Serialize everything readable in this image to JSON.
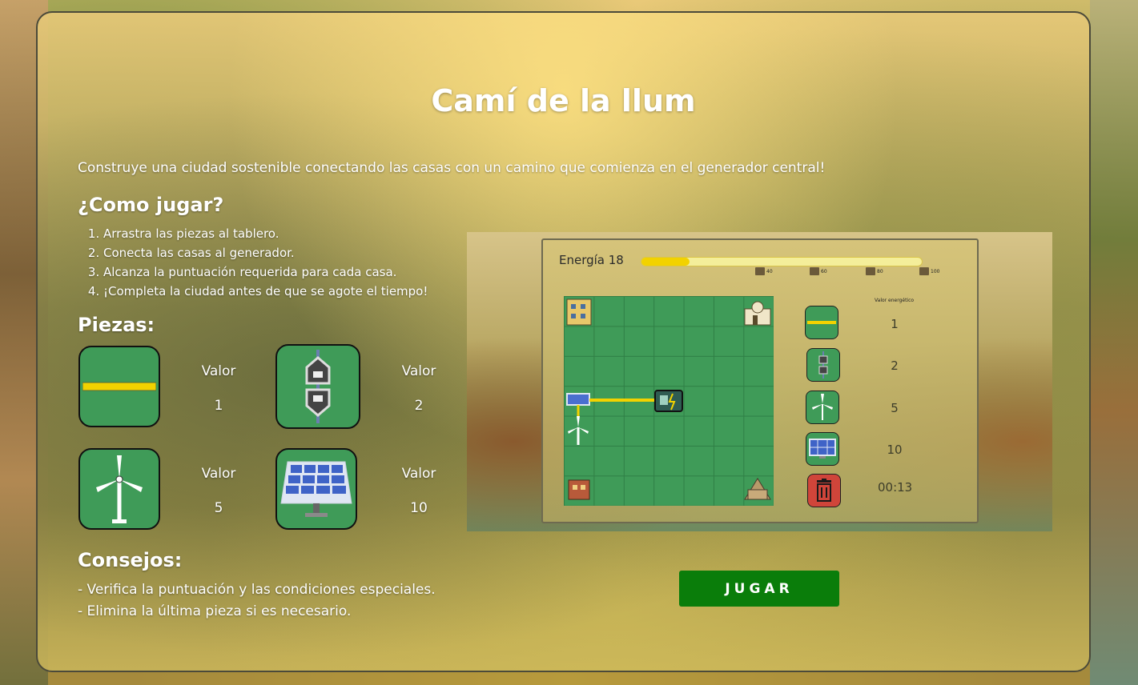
{
  "title": "Camí de la llum",
  "intro": "Construye una ciudad sostenible conectando las casas con un camino que comienza en el generador central!",
  "how_to_play": {
    "heading": "¿Como jugar?",
    "steps": [
      "Arrastra las piezas al tablero.",
      "Conecta las casas al generador.",
      "Alcanza la puntuación requerida para cada casa.",
      "¡Completa la ciudad antes de que se agote el tiempo!"
    ]
  },
  "pieces": {
    "heading": "Piezas:",
    "items": [
      {
        "icon": "cable-icon",
        "label": "Valor",
        "value": "1"
      },
      {
        "icon": "connector-icon",
        "label": "Valor",
        "value": "2"
      },
      {
        "icon": "wind-turbine-icon",
        "label": "Valor",
        "value": "5"
      },
      {
        "icon": "solar-panel-icon",
        "label": "Valor",
        "value": "10"
      }
    ]
  },
  "tips": {
    "heading": "Consejos:",
    "items": [
      "- Verifica la puntuación y las condiciones especiales.",
      "- Elimina la última pieza si es necesario."
    ]
  },
  "play_button": "JUGAR",
  "preview": {
    "energy_label": "Energía 18",
    "energy_fraction": 0.17,
    "milestones": [
      "40",
      "60",
      "80",
      "100"
    ],
    "side_label": "Valor energético",
    "tool_values": [
      "1",
      "2",
      "5",
      "10"
    ],
    "timer": "00:13"
  },
  "colors": {
    "board_green": "#3f9b58",
    "cable_yellow": "#f2d200",
    "play_green": "#0a7d0a",
    "trash_red": "#d0453a"
  }
}
